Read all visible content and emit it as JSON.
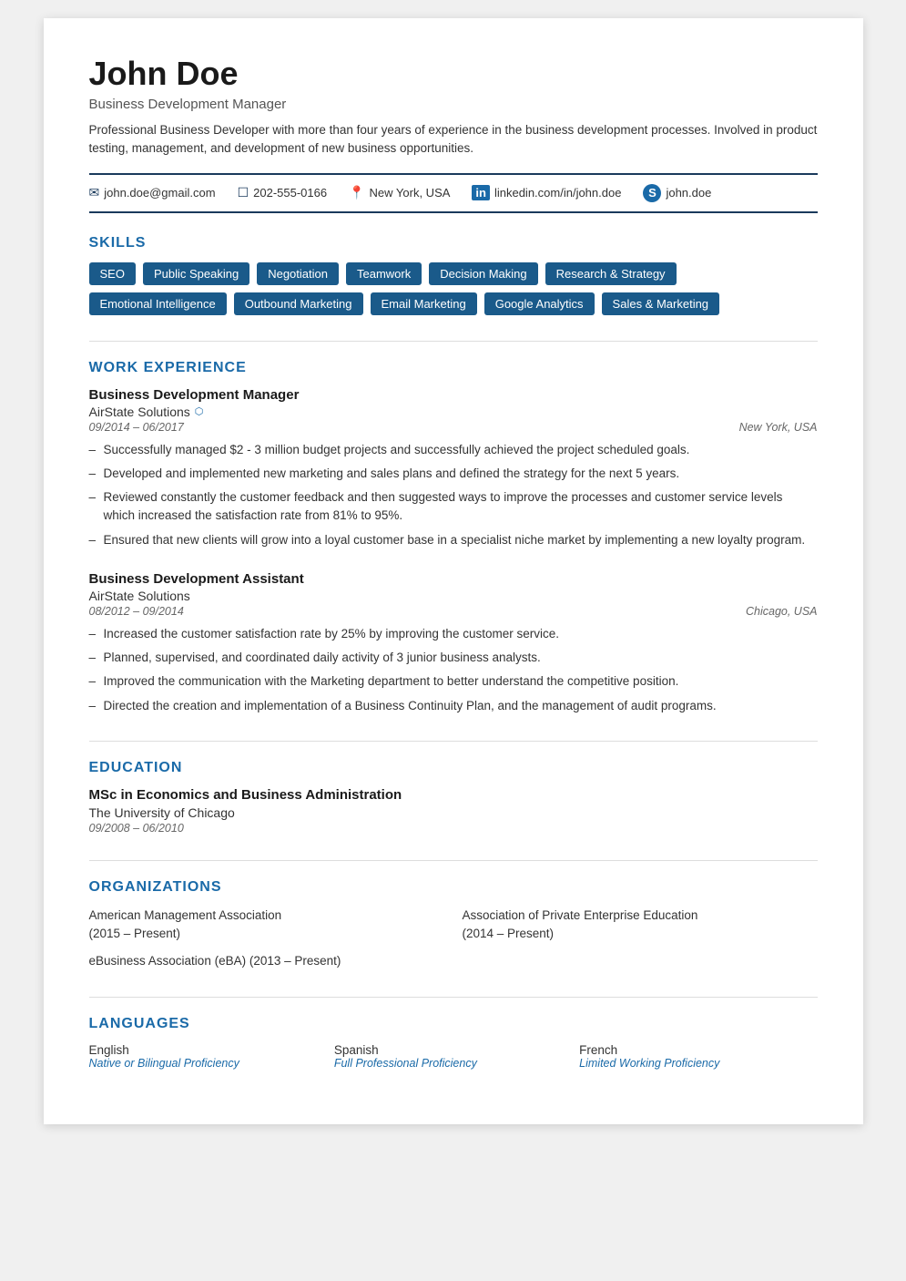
{
  "header": {
    "name": "John Doe",
    "title": "Business Development Manager",
    "summary": "Professional Business Developer with more than four years of experience in the business development processes. Involved in product testing, management, and development of new business opportunities."
  },
  "contact": {
    "email": "john.doe@gmail.com",
    "phone": "202-555-0166",
    "location": "New York, USA",
    "linkedin": "linkedin.com/in/john.doe",
    "skype": "john.doe"
  },
  "skills": {
    "section_title": "SKILLS",
    "row1": [
      "SEO",
      "Public Speaking",
      "Negotiation",
      "Teamwork",
      "Decision Making",
      "Research & Strategy"
    ],
    "row2": [
      "Emotional Intelligence",
      "Outbound Marketing",
      "Email Marketing",
      "Google Analytics",
      "Sales & Marketing"
    ]
  },
  "work_experience": {
    "section_title": "WORK EXPERIENCE",
    "jobs": [
      {
        "title": "Business Development Manager",
        "company": "AirState Solutions",
        "company_link": true,
        "dates": "09/2014 – 06/2017",
        "location": "New York, USA",
        "bullets": [
          "Successfully managed $2 - 3 million budget projects and successfully achieved the project scheduled goals.",
          "Developed and implemented new marketing and sales plans and defined the strategy for the next 5 years.",
          "Reviewed constantly the customer feedback and then suggested ways to improve the processes and customer service levels which increased the satisfaction rate from 81% to 95%.",
          "Ensured that new clients will grow into a loyal customer base in a specialist niche market by implementing a new loyalty program."
        ]
      },
      {
        "title": "Business Development Assistant",
        "company": "AirState Solutions",
        "company_link": false,
        "dates": "08/2012 – 09/2014",
        "location": "Chicago, USA",
        "bullets": [
          "Increased the customer satisfaction rate by 25% by improving the customer service.",
          "Planned, supervised, and coordinated daily activity of 3 junior business analysts.",
          "Improved the communication with the Marketing department to better understand the competitive position.",
          "Directed the creation and implementation of a Business Continuity Plan, and the management of audit programs."
        ]
      }
    ]
  },
  "education": {
    "section_title": "EDUCATION",
    "degree": "MSc in Economics and Business Administration",
    "school": "The University of Chicago",
    "dates": "09/2008 – 06/2010"
  },
  "organizations": {
    "section_title": "ORGANIZATIONS",
    "items": [
      {
        "name": "American Management Association",
        "dates": "(2015 – Present)"
      },
      {
        "name": "Association of Private Enterprise Education",
        "dates": "(2014 – Present)"
      },
      {
        "name": "eBusiness Association (eBA) (2013 – Present)",
        "dates": ""
      }
    ]
  },
  "languages": {
    "section_title": "LANGUAGES",
    "items": [
      {
        "name": "English",
        "level": "Native or Bilingual Proficiency"
      },
      {
        "name": "Spanish",
        "level": "Full Professional Proficiency"
      },
      {
        "name": "French",
        "level": "Limited Working Proficiency"
      }
    ]
  },
  "icons": {
    "email": "✉",
    "phone": "📱",
    "location": "📍",
    "linkedin": "in",
    "skype": "S",
    "external_link": "↗"
  }
}
